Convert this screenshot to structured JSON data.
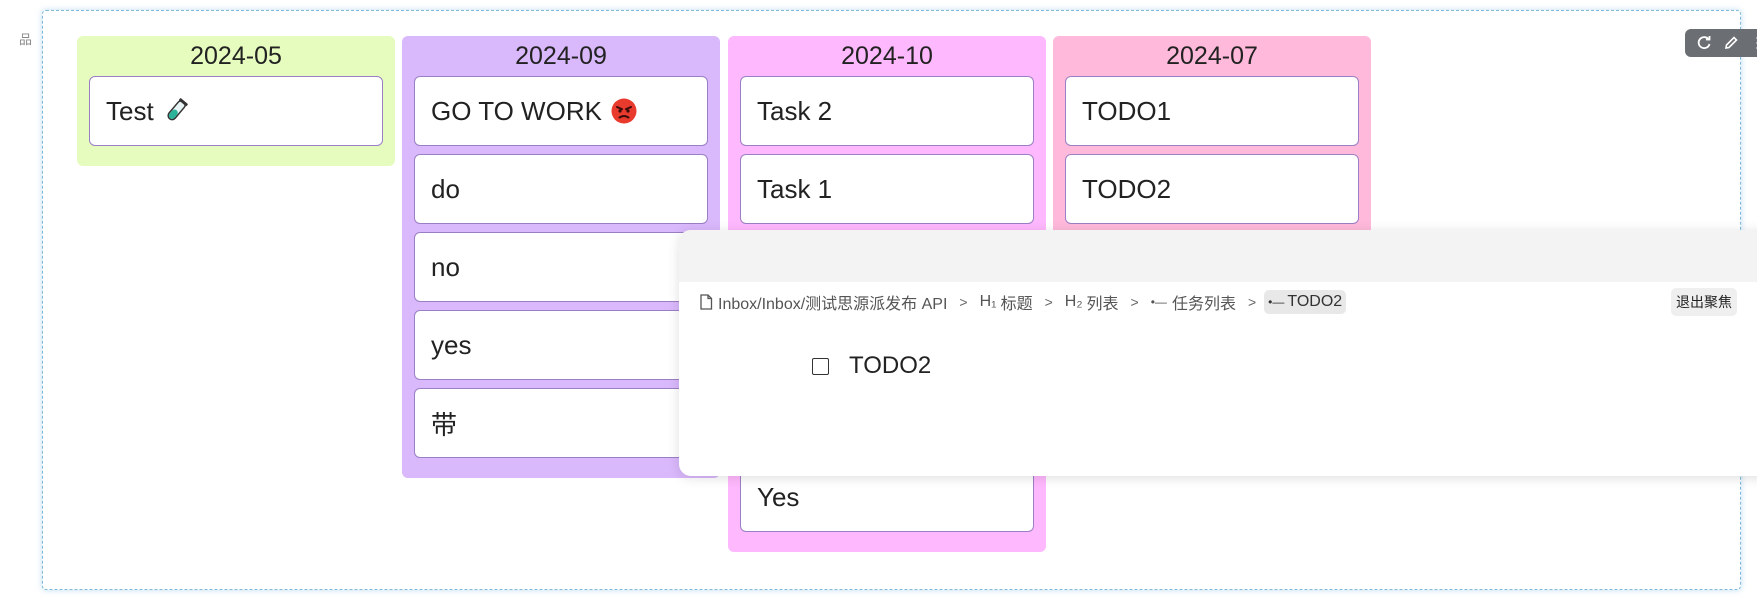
{
  "colors": {
    "frame_border": "#7fb8d8",
    "card_border": "#9b7fc4",
    "toolbar_bg": "#6b6e73"
  },
  "gutter": {
    "icon": "block-type-icon",
    "label": "品"
  },
  "toolbar": {
    "icons": [
      "refresh-icon",
      "edit-icon",
      "more-vertical-icon"
    ]
  },
  "columns": [
    {
      "title": "2024-05",
      "color": "#e6fcbf",
      "cards": [
        {
          "label": "Test",
          "emoji": "test-tube-icon"
        }
      ]
    },
    {
      "title": "2024-09",
      "color": "#d9b8fb",
      "cards": [
        {
          "label": "GO TO WORK",
          "emoji": "angry-face-icon"
        },
        {
          "label": "do"
        },
        {
          "label": "no"
        },
        {
          "label": "yes"
        },
        {
          "label": "带"
        }
      ]
    },
    {
      "title": "2024-10",
      "color": "#feb8fd",
      "cards": [
        {
          "label": "Task 2"
        },
        {
          "label": "Task 1"
        },
        {
          "label": "Yes"
        }
      ]
    },
    {
      "title": "2024-07",
      "color": "#ffb9da",
      "cards": [
        {
          "label": "TODO1"
        },
        {
          "label": "TODO2"
        }
      ]
    }
  ],
  "focus_panel": {
    "breadcrumb": [
      {
        "icon": "document-icon",
        "label": "Inbox/Inbox/测试思源派发布 API"
      },
      {
        "icon": "heading1-icon",
        "prefix": "H₁",
        "label": "标题"
      },
      {
        "icon": "heading2-icon",
        "prefix": "H₂",
        "label": "列表"
      },
      {
        "icon": "list-icon",
        "prefix": "•—",
        "label": "任务列表"
      },
      {
        "icon": "list-item-icon",
        "prefix": "•—",
        "label": "TODO2"
      }
    ],
    "exit_label": "退出聚焦",
    "todo": {
      "label": "TODO2",
      "checked": false
    }
  }
}
